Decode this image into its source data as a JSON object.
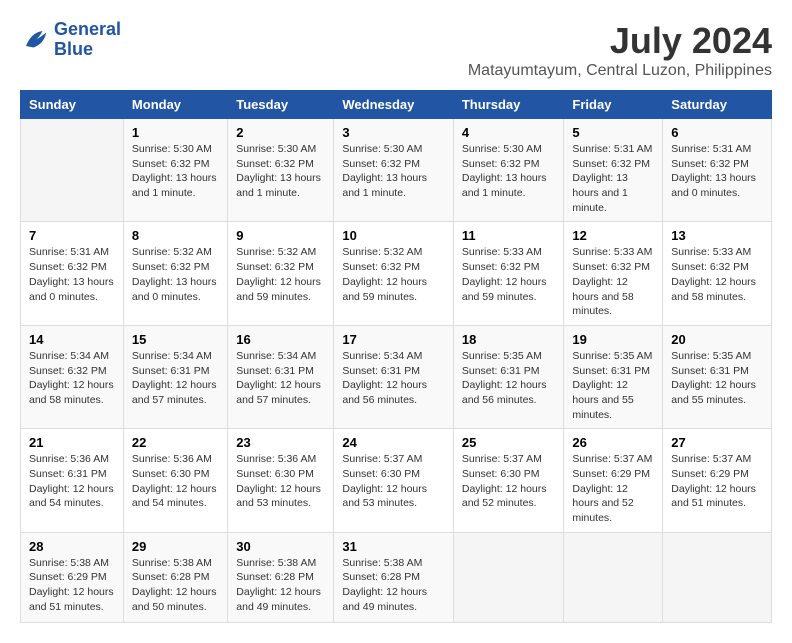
{
  "logo": {
    "line1": "General",
    "line2": "Blue"
  },
  "title": "July 2024",
  "location": "Matayumtayum, Central Luzon, Philippines",
  "weekdays": [
    "Sunday",
    "Monday",
    "Tuesday",
    "Wednesday",
    "Thursday",
    "Friday",
    "Saturday"
  ],
  "weeks": [
    [
      null,
      {
        "day": "1",
        "sunrise": "Sunrise: 5:30 AM",
        "sunset": "Sunset: 6:32 PM",
        "daylight": "Daylight: 13 hours and 1 minute."
      },
      {
        "day": "2",
        "sunrise": "Sunrise: 5:30 AM",
        "sunset": "Sunset: 6:32 PM",
        "daylight": "Daylight: 13 hours and 1 minute."
      },
      {
        "day": "3",
        "sunrise": "Sunrise: 5:30 AM",
        "sunset": "Sunset: 6:32 PM",
        "daylight": "Daylight: 13 hours and 1 minute."
      },
      {
        "day": "4",
        "sunrise": "Sunrise: 5:30 AM",
        "sunset": "Sunset: 6:32 PM",
        "daylight": "Daylight: 13 hours and 1 minute."
      },
      {
        "day": "5",
        "sunrise": "Sunrise: 5:31 AM",
        "sunset": "Sunset: 6:32 PM",
        "daylight": "Daylight: 13 hours and 1 minute."
      },
      {
        "day": "6",
        "sunrise": "Sunrise: 5:31 AM",
        "sunset": "Sunset: 6:32 PM",
        "daylight": "Daylight: 13 hours and 0 minutes."
      }
    ],
    [
      {
        "day": "7",
        "sunrise": "Sunrise: 5:31 AM",
        "sunset": "Sunset: 6:32 PM",
        "daylight": "Daylight: 13 hours and 0 minutes."
      },
      {
        "day": "8",
        "sunrise": "Sunrise: 5:32 AM",
        "sunset": "Sunset: 6:32 PM",
        "daylight": "Daylight: 13 hours and 0 minutes."
      },
      {
        "day": "9",
        "sunrise": "Sunrise: 5:32 AM",
        "sunset": "Sunset: 6:32 PM",
        "daylight": "Daylight: 12 hours and 59 minutes."
      },
      {
        "day": "10",
        "sunrise": "Sunrise: 5:32 AM",
        "sunset": "Sunset: 6:32 PM",
        "daylight": "Daylight: 12 hours and 59 minutes."
      },
      {
        "day": "11",
        "sunrise": "Sunrise: 5:33 AM",
        "sunset": "Sunset: 6:32 PM",
        "daylight": "Daylight: 12 hours and 59 minutes."
      },
      {
        "day": "12",
        "sunrise": "Sunrise: 5:33 AM",
        "sunset": "Sunset: 6:32 PM",
        "daylight": "Daylight: 12 hours and 58 minutes."
      },
      {
        "day": "13",
        "sunrise": "Sunrise: 5:33 AM",
        "sunset": "Sunset: 6:32 PM",
        "daylight": "Daylight: 12 hours and 58 minutes."
      }
    ],
    [
      {
        "day": "14",
        "sunrise": "Sunrise: 5:34 AM",
        "sunset": "Sunset: 6:32 PM",
        "daylight": "Daylight: 12 hours and 58 minutes."
      },
      {
        "day": "15",
        "sunrise": "Sunrise: 5:34 AM",
        "sunset": "Sunset: 6:31 PM",
        "daylight": "Daylight: 12 hours and 57 minutes."
      },
      {
        "day": "16",
        "sunrise": "Sunrise: 5:34 AM",
        "sunset": "Sunset: 6:31 PM",
        "daylight": "Daylight: 12 hours and 57 minutes."
      },
      {
        "day": "17",
        "sunrise": "Sunrise: 5:34 AM",
        "sunset": "Sunset: 6:31 PM",
        "daylight": "Daylight: 12 hours and 56 minutes."
      },
      {
        "day": "18",
        "sunrise": "Sunrise: 5:35 AM",
        "sunset": "Sunset: 6:31 PM",
        "daylight": "Daylight: 12 hours and 56 minutes."
      },
      {
        "day": "19",
        "sunrise": "Sunrise: 5:35 AM",
        "sunset": "Sunset: 6:31 PM",
        "daylight": "Daylight: 12 hours and 55 minutes."
      },
      {
        "day": "20",
        "sunrise": "Sunrise: 5:35 AM",
        "sunset": "Sunset: 6:31 PM",
        "daylight": "Daylight: 12 hours and 55 minutes."
      }
    ],
    [
      {
        "day": "21",
        "sunrise": "Sunrise: 5:36 AM",
        "sunset": "Sunset: 6:31 PM",
        "daylight": "Daylight: 12 hours and 54 minutes."
      },
      {
        "day": "22",
        "sunrise": "Sunrise: 5:36 AM",
        "sunset": "Sunset: 6:30 PM",
        "daylight": "Daylight: 12 hours and 54 minutes."
      },
      {
        "day": "23",
        "sunrise": "Sunrise: 5:36 AM",
        "sunset": "Sunset: 6:30 PM",
        "daylight": "Daylight: 12 hours and 53 minutes."
      },
      {
        "day": "24",
        "sunrise": "Sunrise: 5:37 AM",
        "sunset": "Sunset: 6:30 PM",
        "daylight": "Daylight: 12 hours and 53 minutes."
      },
      {
        "day": "25",
        "sunrise": "Sunrise: 5:37 AM",
        "sunset": "Sunset: 6:30 PM",
        "daylight": "Daylight: 12 hours and 52 minutes."
      },
      {
        "day": "26",
        "sunrise": "Sunrise: 5:37 AM",
        "sunset": "Sunset: 6:29 PM",
        "daylight": "Daylight: 12 hours and 52 minutes."
      },
      {
        "day": "27",
        "sunrise": "Sunrise: 5:37 AM",
        "sunset": "Sunset: 6:29 PM",
        "daylight": "Daylight: 12 hours and 51 minutes."
      }
    ],
    [
      {
        "day": "28",
        "sunrise": "Sunrise: 5:38 AM",
        "sunset": "Sunset: 6:29 PM",
        "daylight": "Daylight: 12 hours and 51 minutes."
      },
      {
        "day": "29",
        "sunrise": "Sunrise: 5:38 AM",
        "sunset": "Sunset: 6:28 PM",
        "daylight": "Daylight: 12 hours and 50 minutes."
      },
      {
        "day": "30",
        "sunrise": "Sunrise: 5:38 AM",
        "sunset": "Sunset: 6:28 PM",
        "daylight": "Daylight: 12 hours and 49 minutes."
      },
      {
        "day": "31",
        "sunrise": "Sunrise: 5:38 AM",
        "sunset": "Sunset: 6:28 PM",
        "daylight": "Daylight: 12 hours and 49 minutes."
      },
      null,
      null,
      null
    ]
  ]
}
